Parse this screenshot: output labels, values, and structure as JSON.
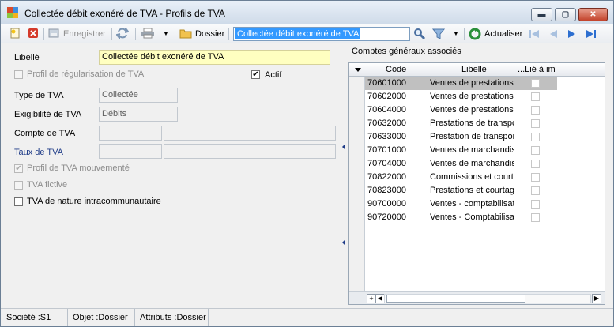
{
  "window": {
    "title": "Collectée débit exonéré de TVA -  Profils de TVA",
    "controls": {
      "minimize": "▬",
      "maximize": "▢",
      "close": "✕"
    }
  },
  "toolbar": {
    "save_label": "Enregistrer",
    "dossier_label": "Dossier",
    "search_value": "Collectée débit exonéré de TVA",
    "refresh_label": "Actualiser"
  },
  "form": {
    "libelle_label": "Libellé",
    "libelle_value": "Collectée débit exonéré de TVA",
    "profil_regularisation_label": "Profil de régularisation de TVA",
    "actif_label": "Actif",
    "actif_checked": "✔",
    "type_label": "Type de TVA",
    "type_value": "Collectée",
    "exigibilite_label": "Exigibilité de TVA",
    "exigibilite_value": "Débits",
    "compte_label": "Compte de TVA",
    "taux_label": "Taux de TVA",
    "profil_mouvemente_label": "Profil de TVA mouvementé",
    "profil_mouvemente_checked": "✔",
    "tva_fictive_label": "TVA fictive",
    "nature_intra_label": "TVA de nature intracommunautaire"
  },
  "grid": {
    "title": "Comptes généraux associés",
    "columns": [
      "Code",
      "Libellé",
      "...Lié à im"
    ],
    "rows": [
      {
        "code": "70601000",
        "libelle": "Ventes de prestations",
        "selected": true
      },
      {
        "code": "70602000",
        "libelle": "Ventes de prestations"
      },
      {
        "code": "70604000",
        "libelle": "Ventes de prestations"
      },
      {
        "code": "70632000",
        "libelle": "Prestations de transport"
      },
      {
        "code": "70633000",
        "libelle": "Prestation de transport"
      },
      {
        "code": "70701000",
        "libelle": "Ventes de marchandises"
      },
      {
        "code": "70704000",
        "libelle": "Ventes de marchandises"
      },
      {
        "code": "70822000",
        "libelle": "Commissions et courtage"
      },
      {
        "code": "70823000",
        "libelle": "Prestations et courtage"
      },
      {
        "code": "90700000",
        "libelle": "Ventes - comptabilisation"
      },
      {
        "code": "90720000",
        "libelle": "Ventes - Comptabilisation"
      }
    ],
    "add_symbol": "+"
  },
  "status": {
    "societe": "Société :S1",
    "objet": "Objet :Dossier",
    "attributs": "Attributs :Dossier"
  },
  "colors": {
    "selection": "#3399ff",
    "row_selected": "#c0c0c0",
    "libelle_field": "#ffffc0",
    "link_label": "#1f3c88"
  }
}
